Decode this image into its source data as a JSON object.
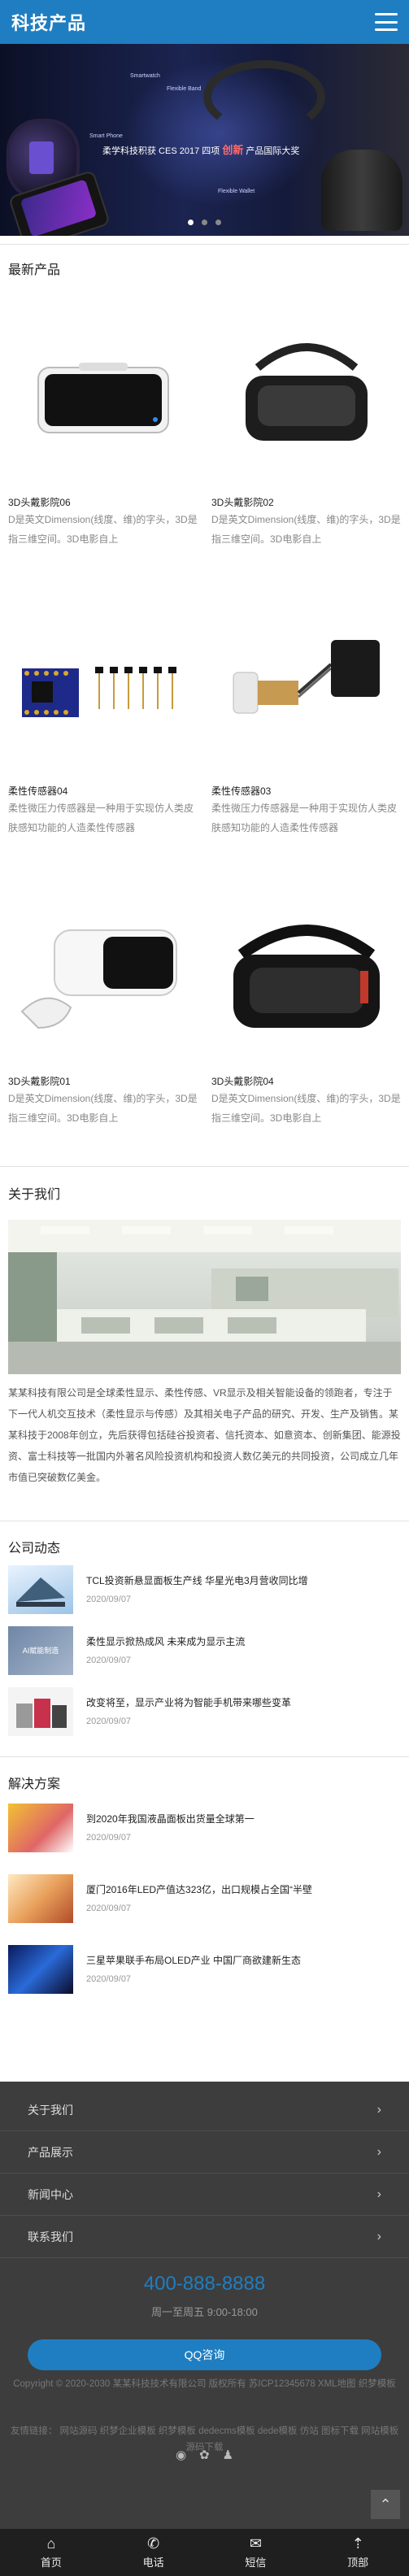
{
  "header": {
    "logo": "科技产品"
  },
  "banner": {
    "tagline_pre": "柔学科技积获 CES 2017 四项",
    "tagline_highlight": "创新",
    "tagline_post": "产品国际大奖",
    "mini_labels": [
      "Smartwatch",
      "Flexible Band",
      "Smart Phone",
      "Flexible Wallet"
    ]
  },
  "latest": {
    "title": "最新产品",
    "items": [
      {
        "name": "3D头戴影院06",
        "desc": "D是英文Dimension(线度、维)的字头，3D是指三维空间。3D电影自上"
      },
      {
        "name": "3D头戴影院02",
        "desc": "D是英文Dimension(线度、维)的字头，3D是指三维空间。3D电影自上"
      },
      {
        "name": "柔性传感器04",
        "desc": "柔性微压力传感器是一种用于实现仿人类皮肤感知功能的人造柔性传感器"
      },
      {
        "name": "柔性传感器03",
        "desc": "柔性微压力传感器是一种用于实现仿人类皮肤感知功能的人造柔性传感器"
      },
      {
        "name": "3D头戴影院01",
        "desc": "D是英文Dimension(线度、维)的字头，3D是指三维空间。3D电影自上"
      },
      {
        "name": "3D头戴影院04",
        "desc": "D是英文Dimension(线度、维)的字头，3D是指三维空间。3D电影自上"
      }
    ]
  },
  "about": {
    "title": "关于我们",
    "text": "某某科技有限公司是全球柔性显示、柔性传感、VR显示及相关智能设备的领跑者，专注于下一代人机交互技术（柔性显示与传感）及其相关电子产品的研究、开发、生产及销售。某某科技于2008年创立，先后获得包括硅谷投资者、信托资本、如意资本、创新集团、能源投资、富士科技等一批国内外著名风险投资机构和投资人数亿美元的共同投资，公司成立几年市值已突破数亿美金。"
  },
  "company_news": {
    "title": "公司动态",
    "items": [
      {
        "title": "TCL投资新悬显面板生产线 华星光电3月营收同比增",
        "date": "2020/09/07"
      },
      {
        "title": "柔性显示掀热成风 未来成为显示主流",
        "date": "2020/09/07"
      },
      {
        "title": "改变将至，显示产业将为智能手机带来哪些变革",
        "date": "2020/09/07"
      }
    ],
    "thumb_label": "AI赋能制造"
  },
  "solutions": {
    "title": "解决方案",
    "items": [
      {
        "title": "到2020年我国液晶面板出货量全球第一",
        "date": "2020/09/07"
      },
      {
        "title": "厦门2016年LED产值达323亿，出口规模占全国“半壁",
        "date": "2020/09/07"
      },
      {
        "title": "三星苹果联手布局OLED产业 中国厂商欲建新生态",
        "date": "2020/09/07"
      }
    ]
  },
  "footer": {
    "links": [
      "关于我们",
      "产品展示",
      "新闻中心",
      "联系我们"
    ],
    "phone": "400-888-8888",
    "hours": "周一至周五 9:00-18:00",
    "qq": "QQ咨询",
    "copyright": "Copyright © 2020-2030 某某科技技术有限公司 版权所有 苏ICP12345678 XML地图 织梦模板",
    "friends": "友情链接：  网站源码  织梦企业模板  织梦模板  dedecms模板  dede模板  仿站  图标下载  网站模板  源码下载"
  },
  "tabbar": {
    "items": [
      {
        "label": "首页",
        "icon": "home-icon"
      },
      {
        "label": "电话",
        "icon": "phone-icon"
      },
      {
        "label": "短信",
        "icon": "message-icon"
      },
      {
        "label": "顶部",
        "icon": "top-icon"
      }
    ]
  },
  "colors": {
    "brand": "#1f7ec1",
    "footer_bg": "#3d3d3d",
    "tabbar_bg": "#1f1f1f"
  }
}
